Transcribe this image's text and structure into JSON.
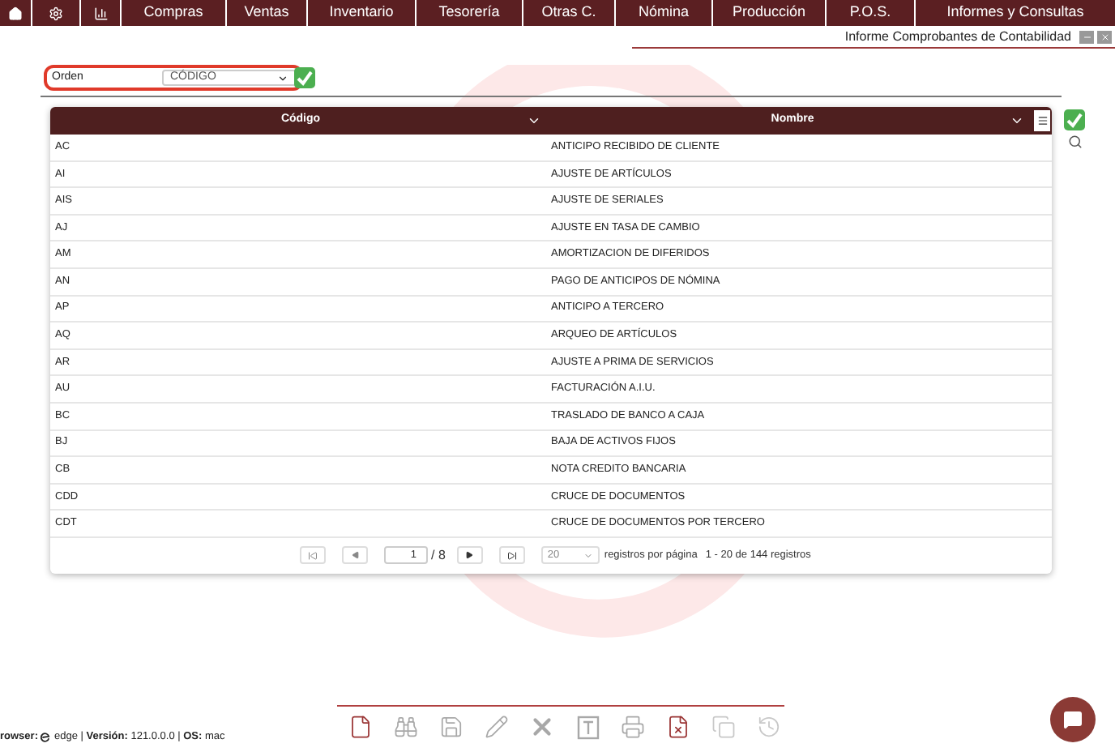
{
  "menu": [
    "Compras",
    "Ventas",
    "Inventario",
    "Tesorería",
    "Otras C.",
    "Nómina",
    "Producción",
    "P.O.S.",
    "Informes y Consultas"
  ],
  "window": {
    "title": "Informe Comprobantes de Contabilidad"
  },
  "filter": {
    "label": "Orden",
    "value": "CÓDIGO"
  },
  "table": {
    "columns": [
      "Código",
      "Nombre"
    ],
    "rows": [
      [
        "AC",
        "ANTICIPO RECIBIDO DE CLIENTE"
      ],
      [
        "AI",
        "AJUSTE DE ARTÍCULOS"
      ],
      [
        "AIS",
        "AJUSTE DE SERIALES"
      ],
      [
        "AJ",
        "AJUSTE EN TASA DE CAMBIO"
      ],
      [
        "AM",
        "AMORTIZACION DE DIFERIDOS"
      ],
      [
        "AN",
        "PAGO DE ANTICIPOS DE NÓMINA"
      ],
      [
        "AP",
        "ANTICIPO A TERCERO"
      ],
      [
        "AQ",
        "ARQUEO DE ARTÍCULOS"
      ],
      [
        "AR",
        "AJUSTE A PRIMA DE SERVICIOS"
      ],
      [
        "AU",
        "FACTURACIÓN A.I.U."
      ],
      [
        "BC",
        "TRASLADO DE BANCO A CAJA"
      ],
      [
        "BJ",
        "BAJA DE ACTIVOS FIJOS"
      ],
      [
        "CB",
        "NOTA CREDITO BANCARIA"
      ],
      [
        "CDD",
        "CRUCE DE DOCUMENTOS"
      ],
      [
        "CDT",
        "CRUCE DE DOCUMENTOS POR TERCERO"
      ]
    ]
  },
  "pager": {
    "page": "1",
    "total_pages": "/ 8",
    "page_size": "20",
    "page_size_label": "registros por página",
    "summary": "1 - 20 de 144 registros"
  },
  "status": {
    "browser_label": "**rowser:**",
    "info": "edge | **Versión:** 121.0.0.0 | **OS:** mac"
  },
  "toolbar": [
    {
      "kind": "new",
      "disabled": false
    },
    {
      "kind": "find",
      "disabled": true
    },
    {
      "kind": "save",
      "disabled": true
    },
    {
      "kind": "edit",
      "disabled": true
    },
    {
      "kind": "delete",
      "disabled": true
    },
    {
      "kind": "text",
      "disabled": true
    },
    {
      "kind": "print",
      "disabled": true
    },
    {
      "kind": "excel",
      "disabled": false
    },
    {
      "kind": "copy",
      "disabled": true
    },
    {
      "kind": "history",
      "disabled": true
    }
  ]
}
